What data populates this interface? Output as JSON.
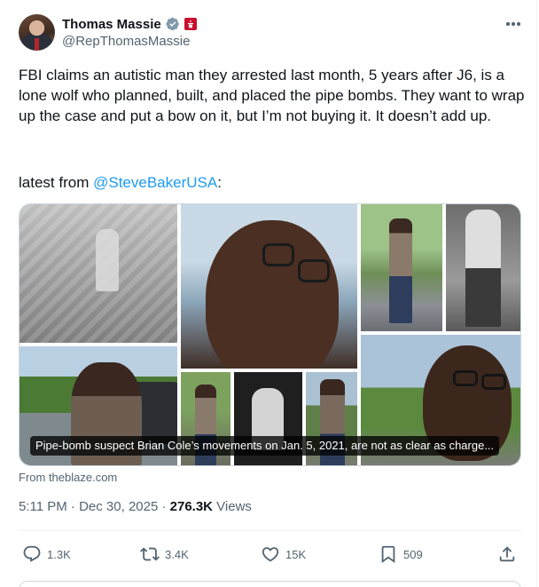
{
  "author": {
    "display_name": "Thomas Massie",
    "handle": "@RepThomasMassie",
    "avatar_icon": "profile-photo",
    "verified_icon": "verified-badge-icon",
    "affiliation_icon": "flag-icon"
  },
  "tweet": {
    "text": "FBI claims an autistic man they arrested last month, 5 years after J6, is a lone wolf who planned, built, and placed the pipe bombs. They want to wrap up the case and put a bow on it, but I’m not buying it. It doesn’t add up.",
    "latest_prefix": "latest from ",
    "mention": "@SteveBakerUSA",
    "latest_suffix": ":"
  },
  "media": {
    "caption": "Pipe-bomb suspect Brian Cole’s movements on Jan. 5, 2021, are not as clear as charge...",
    "source": "From theblaze.com"
  },
  "meta": {
    "time_date": "5:11 PM · Dec 30, 2025 · ",
    "views_count": "276.3K",
    "views_label": " Views"
  },
  "actions": {
    "replies": "1.3K",
    "reposts": "3.4K",
    "likes": "15K",
    "bookmarks": "509"
  },
  "colors": {
    "text": "#0f1419",
    "secondary": "#536471",
    "link": "#1d9bf0",
    "verified": "#829aab",
    "flag": "#c8102e"
  }
}
